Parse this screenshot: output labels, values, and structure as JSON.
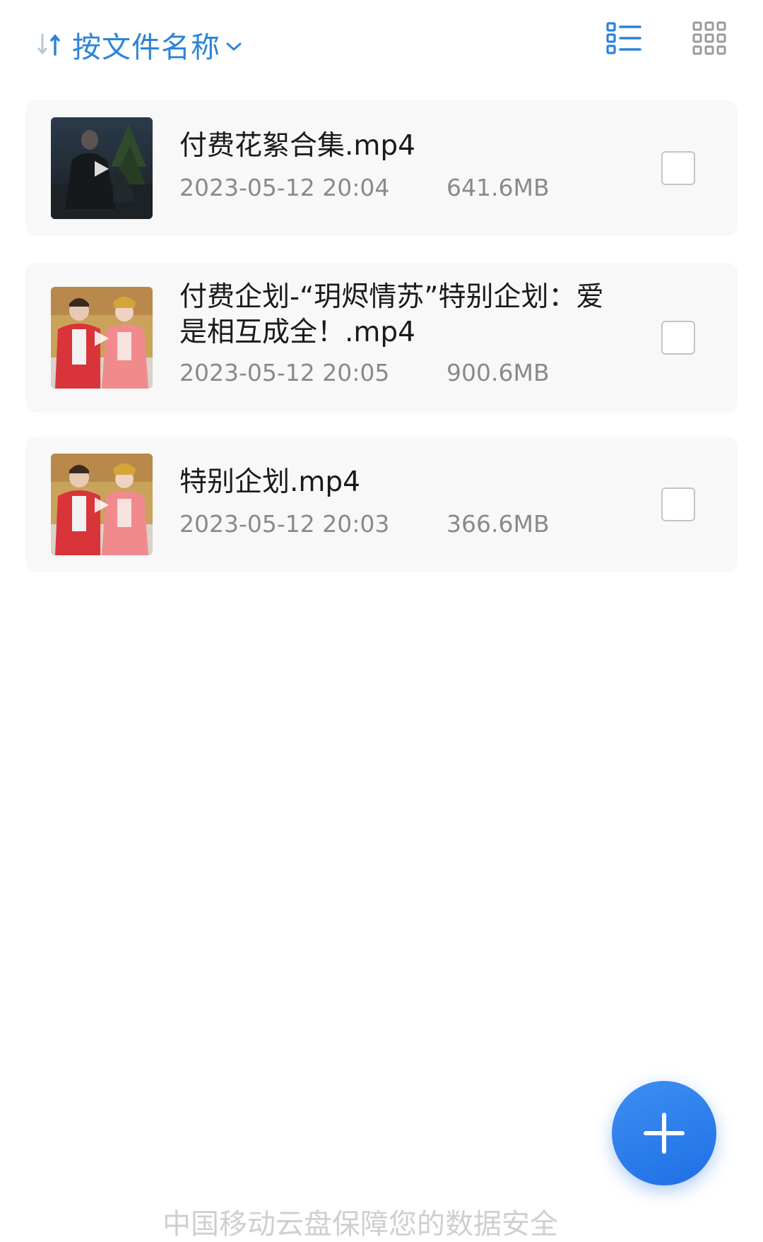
{
  "toolbar": {
    "sort_label": "按文件名称",
    "sort_icon": "sort-arrows-icon",
    "list_view_icon": "list-view-icon",
    "grid_view_icon": "grid-view-icon",
    "accent_color": "#2b84d8"
  },
  "files": [
    {
      "name": "付费花絮合集.mp4",
      "date": "2023-05-12 20:04",
      "size": "641.6MB",
      "checked": false
    },
    {
      "name": "付费企划-“玥烬情苏”特别企划：爱是相互成全！.mp4",
      "date": "2023-05-12 20:05",
      "size": "900.6MB",
      "checked": false
    },
    {
      "name": "特别企划.mp4",
      "date": "2023-05-12 20:03",
      "size": "366.6MB",
      "checked": false
    }
  ],
  "fab": {
    "icon": "plus-icon",
    "color": "#1f6fe6"
  },
  "footer": {
    "note": "中国移动云盘保障您的数据安全"
  }
}
